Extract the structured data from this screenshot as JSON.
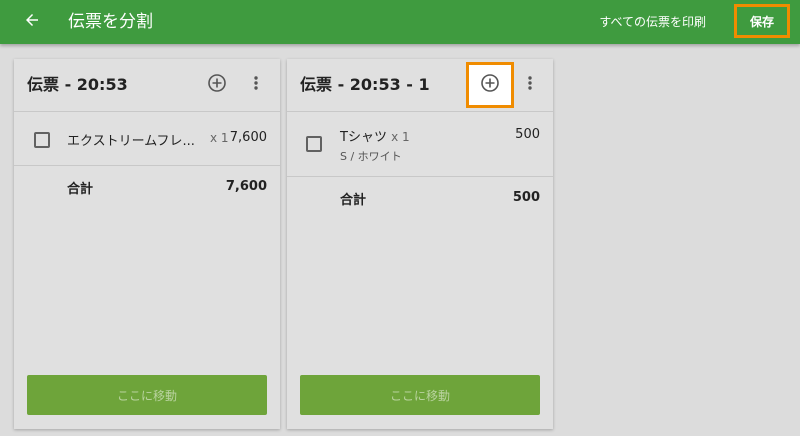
{
  "appbar": {
    "title": "伝票を分割",
    "back_icon": "arrow-left-icon",
    "print_all_label": "すべての伝票を印刷",
    "save_label": "保存",
    "color": "#3f9b3f"
  },
  "cards": [
    {
      "title": "伝票 - 20:53",
      "items": [
        {
          "name": "エクストリームフレ...",
          "qty": "x 1",
          "price": "7,600",
          "variant": ""
        }
      ],
      "total_label": "合計",
      "total_value": "7,600",
      "move_label": "ここに移動"
    },
    {
      "title": "伝票 - 20:53 - 1",
      "items": [
        {
          "name": "Tシャツ",
          "qty": "x 1",
          "price": "500",
          "variant": "S / ホワイト"
        }
      ],
      "total_label": "合計",
      "total_value": "500",
      "move_label": "ここに移動"
    }
  ],
  "highlight_color": "#f08c00"
}
